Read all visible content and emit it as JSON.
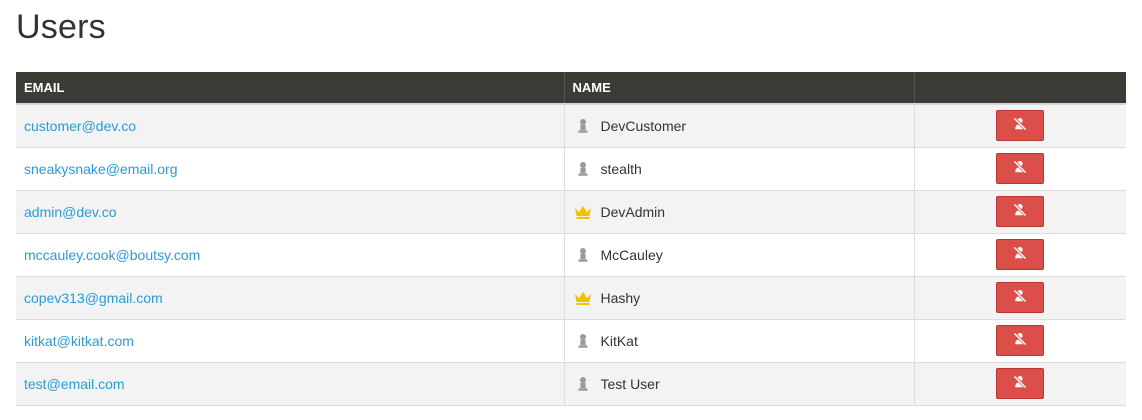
{
  "page": {
    "title": "Users"
  },
  "table": {
    "columns": [
      "EMAIL",
      "NAME",
      ""
    ],
    "rows": [
      {
        "email": "customer@dev.co",
        "name": "DevCustomer",
        "role_icon": "user-icon"
      },
      {
        "email": "sneakysnake@email.org",
        "name": "stealth",
        "role_icon": "user-icon"
      },
      {
        "email": "admin@dev.co",
        "name": "DevAdmin",
        "role_icon": "crown-icon"
      },
      {
        "email": "mccauley.cook@boutsy.com",
        "name": "McCauley",
        "role_icon": "user-icon"
      },
      {
        "email": "copev313@gmail.com",
        "name": "Hashy",
        "role_icon": "crown-icon"
      },
      {
        "email": "kitkat@kitkat.com",
        "name": "KitKat",
        "role_icon": "user-icon"
      },
      {
        "email": "test@email.com",
        "name": "Test User",
        "role_icon": "user-icon"
      }
    ]
  },
  "actions": {
    "row_button_icon": "user-slash-icon"
  },
  "colors": {
    "header_bg": "#3c3b36",
    "link": "#2b9bd3",
    "danger": "#dc4e4a",
    "crown": "#f2c200",
    "user_icon": "#9a9a9a"
  }
}
